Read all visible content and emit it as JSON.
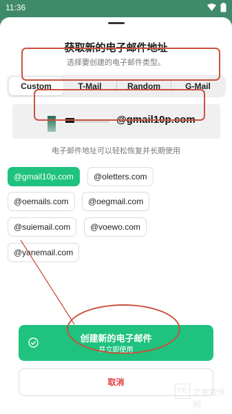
{
  "status_bar": {
    "time": "11:36",
    "wifi_icon": "wifi-icon",
    "battery_icon": "battery-icon"
  },
  "sheet": {
    "title": "获取新的电子邮件地址",
    "subtitle": "选择要创建的电子邮件类型。",
    "tabs": [
      {
        "label": "Custom",
        "active": true
      },
      {
        "label": "T-Mail",
        "active": false
      },
      {
        "label": "Random",
        "active": false
      },
      {
        "label": "G-Mail",
        "active": false
      }
    ],
    "email_preview": {
      "domain": "@gmail10p.com"
    },
    "hint": "电子邮件地址可以轻松恢复并长期使用",
    "domains": [
      {
        "label": "@gmail10p.com",
        "selected": true
      },
      {
        "label": "@oletters.com",
        "selected": false
      },
      {
        "label": "@oemails.com",
        "selected": false
      },
      {
        "label": "@oegmail.com",
        "selected": false
      },
      {
        "label": "@suiemail.com",
        "selected": false
      },
      {
        "label": "@voewo.com",
        "selected": false
      },
      {
        "label": "@yanemail.com",
        "selected": false
      }
    ],
    "create_button": {
      "main": "创建新的电子邮件",
      "sub": "并立即使用",
      "icon": "check-circle-icon"
    },
    "cancel_button": {
      "label": "取消"
    }
  },
  "watermark": {
    "box": "PE",
    "text": "之家软件网"
  },
  "colors": {
    "brand_green": "#1fc27e",
    "annotation_red": "#c9503c",
    "cancel_red": "#e23b3b",
    "status_bg": "#3f8a6a"
  }
}
